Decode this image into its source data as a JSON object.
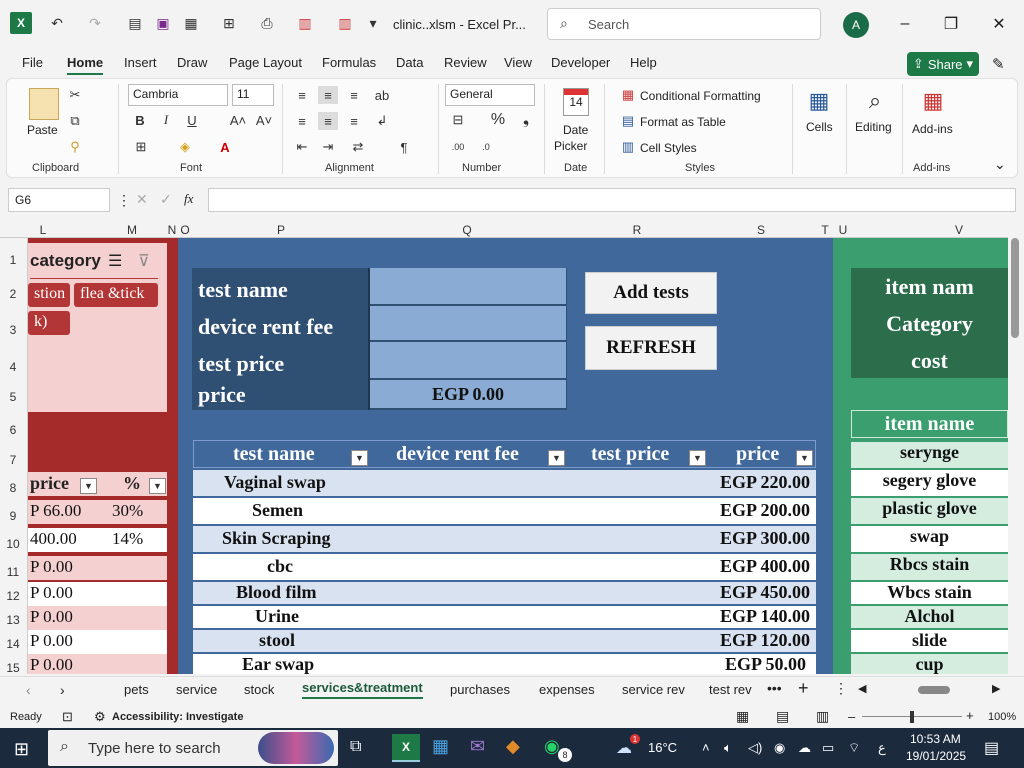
{
  "title_bar": {
    "file_title": "clinic..xlsm  -  Excel Pr...",
    "search_placeholder": "Search",
    "avatar_initial": "A"
  },
  "menu": {
    "tabs": [
      "File",
      "Home",
      "Insert",
      "Draw",
      "Page Layout",
      "Formulas",
      "Data",
      "Review",
      "View",
      "Developer",
      "Help"
    ],
    "active": "Home",
    "share_label": "Share"
  },
  "ribbon": {
    "clipboard": {
      "paste": "Paste",
      "label": "Clipboard"
    },
    "font": {
      "name": "Cambria",
      "size": "11",
      "label": "Font"
    },
    "alignment": {
      "label": "Alignment"
    },
    "number": {
      "format": "General",
      "label": "Number"
    },
    "date": {
      "day": "14",
      "line1": "Date",
      "line2": "Picker",
      "label": "Date"
    },
    "styles": {
      "cond": "Conditional Formatting",
      "table": "Format as Table",
      "cell": "Cell Styles",
      "label": "Styles"
    },
    "cells": {
      "label": "Cells"
    },
    "editing": {
      "label": "Editing"
    },
    "addins": {
      "button": "Add-ins",
      "label": "Add-ins"
    }
  },
  "formula_bar": {
    "name_box": "G6",
    "fx": "fx",
    "value": ""
  },
  "columns": [
    "L",
    "M",
    "N",
    "O",
    "P",
    "Q",
    "R",
    "S",
    "T",
    "U",
    "V"
  ],
  "rows": [
    "1",
    "2",
    "3",
    "4",
    "5",
    "6",
    "7",
    "8",
    "9",
    "10",
    "11",
    "12",
    "13",
    "14",
    "15"
  ],
  "left_panel": {
    "slicer_title": "category",
    "slicer_items": [
      "stion",
      "flea &tick",
      "k)"
    ],
    "col_price": "price",
    "col_pct": "%",
    "rows": [
      {
        "price": "P 66.00",
        "pct": "30%"
      },
      {
        "price": " 400.00",
        "pct": "14%"
      },
      {
        "price": "P 0.00",
        "pct": ""
      },
      {
        "price": "P 0.00",
        "pct": ""
      },
      {
        "price": "P 0.00",
        "pct": ""
      },
      {
        "price": "P 0.00",
        "pct": ""
      },
      {
        "price": "P 0.00",
        "pct": ""
      }
    ]
  },
  "form": {
    "labels": [
      "test name",
      "device rent fee",
      "test price",
      "price"
    ],
    "price_value": "EGP 0.00",
    "add_button": "Add tests",
    "refresh_button": "REFRESH"
  },
  "tests_table": {
    "headers": [
      "test name",
      "device rent fee",
      "test price",
      "price"
    ],
    "rows": [
      {
        "name": "Vaginal swap",
        "price": "EGP 220.00"
      },
      {
        "name": "Semen",
        "price": "EGP 200.00"
      },
      {
        "name": "Skin Scraping",
        "price": "EGP 300.00"
      },
      {
        "name": "cbc",
        "price": "EGP 400.00"
      },
      {
        "name": "Blood film",
        "price": "EGP 450.00"
      },
      {
        "name": "Urine",
        "price": "EGP 140.00"
      },
      {
        "name": "stool",
        "price": "EGP 120.00"
      },
      {
        "name": "Ear swap",
        "price": "EGP 50.00"
      }
    ]
  },
  "right_panel": {
    "form_labels": [
      "item nam",
      "Category",
      "cost"
    ],
    "table_header": "item name",
    "items": [
      "serynge",
      "segery glove",
      "plastic glove",
      "swap",
      "Rbcs stain",
      "Wbcs stain",
      "Alchol",
      "slide",
      "cup"
    ]
  },
  "sheet_tabs": [
    "pets",
    "service",
    "stock",
    "services&treatment",
    "purchases",
    "expenses",
    "service rev",
    "test rev"
  ],
  "active_sheet": "services&treatment",
  "status": {
    "ready": "Ready",
    "accessibility": "Accessibility: Investigate",
    "zoom": "100%"
  },
  "taskbar": {
    "search_placeholder": "Type here to search",
    "weather": "16°C",
    "lang": "ع",
    "time": "10:53 AM",
    "date": "19/01/2025",
    "badge": "8",
    "weather_badge": "1"
  }
}
